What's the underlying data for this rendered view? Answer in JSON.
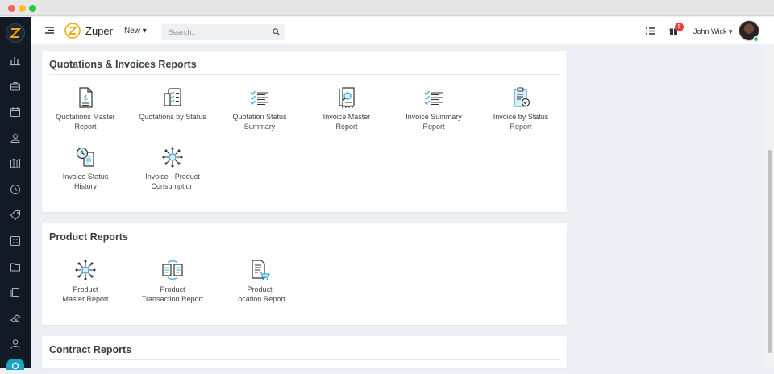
{
  "header": {
    "brand": "Zuper",
    "new_label": "New ▾",
    "search_placeholder": "Search..",
    "notification_count": "5",
    "user_name": "John Wick ▾"
  },
  "sections": [
    {
      "title": "Quotations & Invoices Reports",
      "items": [
        {
          "label_line1": "Quotations Master",
          "label_line2": "Report",
          "icon": "document-dollar-icon"
        },
        {
          "label_line1": "Quotations by Status",
          "label_line2": "",
          "icon": "checklist-clipboard-icon"
        },
        {
          "label_line1": "Quotation Status",
          "label_line2": "Summary",
          "icon": "check-list-icon"
        },
        {
          "label_line1": "Invoice Master",
          "label_line2": "Report",
          "icon": "invoice-magnify-icon"
        },
        {
          "label_line1": "Invoice Summary",
          "label_line2": "Report",
          "icon": "check-list-icon"
        },
        {
          "label_line1": "Invoice by Status",
          "label_line2": "Report",
          "icon": "clipboard-check-icon"
        },
        {
          "label_line1": "Invoice Status",
          "label_line2": "History",
          "icon": "clock-document-icon"
        },
        {
          "label_line1": "Invoice - Product",
          "label_line2": "Consumption",
          "icon": "network-hub-icon"
        }
      ]
    },
    {
      "title": "Product Reports",
      "items": [
        {
          "label_line1": "Product",
          "label_line2": "Master Report",
          "icon": "network-hub-icon"
        },
        {
          "label_line1": "Product",
          "label_line2": "Transaction Report",
          "icon": "exchange-documents-icon"
        },
        {
          "label_line1": "Product",
          "label_line2": "Location Report",
          "icon": "document-cart-icon"
        }
      ]
    },
    {
      "title": "Contract Reports",
      "items": []
    }
  ],
  "colors": {
    "sidebar": "#121a26",
    "accent": "#1aa3c7",
    "icon_blue": "#3aa7d8",
    "badge": "#e5413a"
  }
}
